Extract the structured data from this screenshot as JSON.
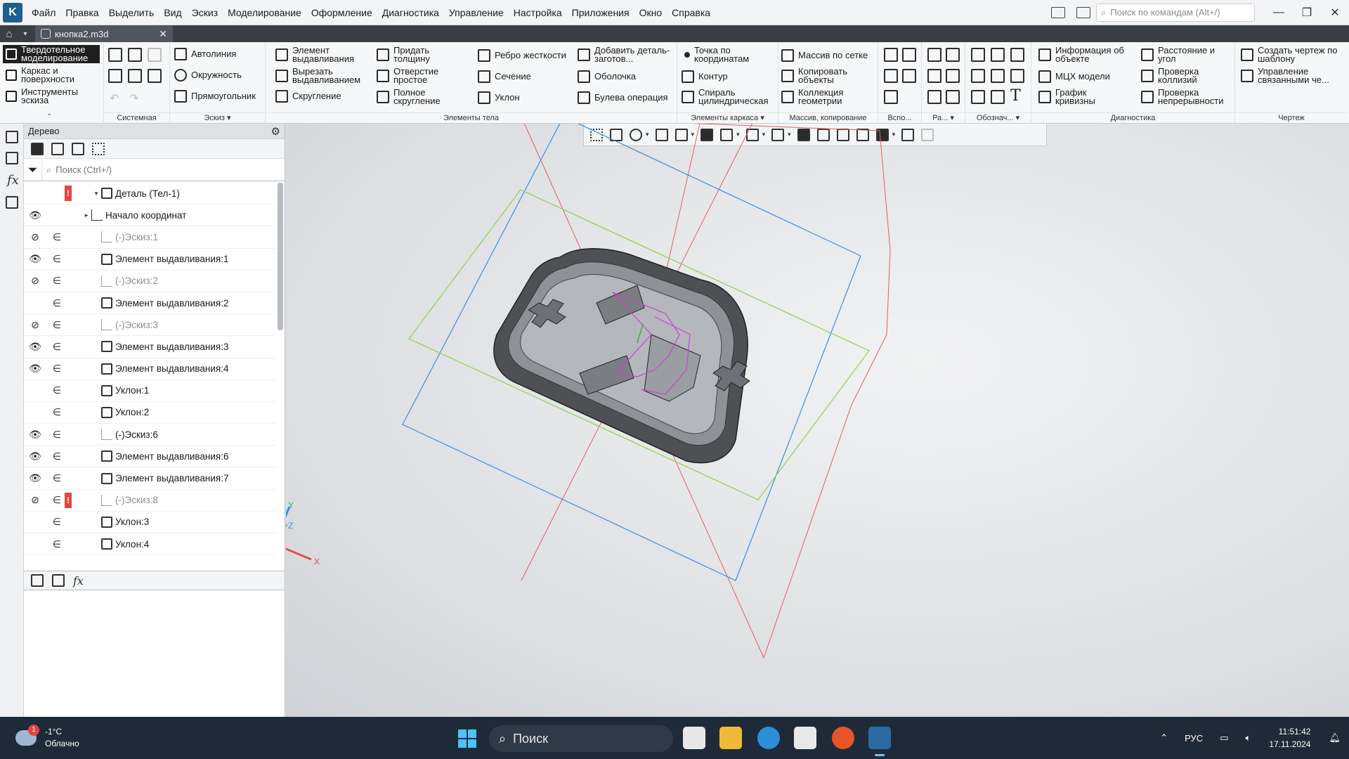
{
  "menubar": {
    "items": [
      "Файл",
      "Правка",
      "Выделить",
      "Вид",
      "Эскиз",
      "Моделирование",
      "Оформление",
      "Диагностика",
      "Управление",
      "Настройка",
      "Приложения",
      "Окно",
      "Справка"
    ],
    "search_placeholder": "Поиск по командам (Alt+/)"
  },
  "tabs": {
    "document": "кнопка2.m3d"
  },
  "ribbon": {
    "modes": [
      "Твердотельное моделирование",
      "Каркас и поверхности",
      "Инструменты эскиза"
    ],
    "groups": {
      "system": "Системная",
      "sketch": "Эскиз",
      "body_elements": "Элементы тела",
      "frame_elements": "Элементы каркаса",
      "array_copy": "Массив, копирование",
      "aux": "Вспо...",
      "ra": "Ра...",
      "designations": "Обознач...",
      "diagnostics": "Диагностика",
      "drawing": "Чертеж"
    },
    "sketch_cmds": [
      "Автолиния",
      "Окружность",
      "Прямоугольник"
    ],
    "body_cmds": [
      "Элемент выдавливания",
      "Вырезать выдавливанием",
      "Скругление",
      "Придать толщину",
      "Отверстие простое",
      "Полное скругление",
      "Ребро жесткости",
      "Сечение",
      "Уклон",
      "Добавить деталь-заготов...",
      "Оболочка",
      "Булева операция"
    ],
    "frame_cmds": [
      "Точка по координатам",
      "Контур",
      "Спираль цилиндрическая"
    ],
    "array_cmds": [
      "Массив по сетке",
      "Копировать объекты",
      "Коллекция геометрии"
    ],
    "diag_cmds": [
      "Информация об объекте",
      "МЦХ модели",
      "График кривизны",
      "Расстояние и угол",
      "Проверка коллизий",
      "Проверка непрерывности"
    ],
    "drawing_cmds": [
      "Создать чертеж по шаблону",
      "Управление связанными че..."
    ]
  },
  "tree": {
    "title": "Дерево",
    "search_placeholder": "Поиск (Ctrl+/)",
    "items": [
      {
        "name": "Деталь (Тел-1)",
        "eye": "",
        "state": "",
        "error": true,
        "dim": false,
        "type": "part",
        "expander": "▾"
      },
      {
        "name": "Начало координат",
        "eye": "👁",
        "state": "",
        "error": false,
        "dim": false,
        "type": "origin",
        "expander": "▸"
      },
      {
        "name": "(-)Эскиз:1",
        "eye": "⊘",
        "state": "∈",
        "error": false,
        "dim": true,
        "type": "sketch",
        "expander": ""
      },
      {
        "name": "Элемент выдавливания:1",
        "eye": "👁",
        "state": "∈",
        "error": false,
        "dim": false,
        "type": "extrude",
        "expander": ""
      },
      {
        "name": "(-)Эскиз:2",
        "eye": "⊘",
        "state": "∈",
        "error": false,
        "dim": true,
        "type": "sketch",
        "expander": ""
      },
      {
        "name": "Элемент выдавливания:2",
        "eye": "",
        "state": "∈",
        "error": false,
        "dim": false,
        "type": "extrude",
        "expander": ""
      },
      {
        "name": "(-)Эскиз:3",
        "eye": "⊘",
        "state": "∈",
        "error": false,
        "dim": true,
        "type": "sketch",
        "expander": ""
      },
      {
        "name": "Элемент выдавливания:3",
        "eye": "👁",
        "state": "∈",
        "error": false,
        "dim": false,
        "type": "extrude",
        "expander": ""
      },
      {
        "name": "Элемент выдавливания:4",
        "eye": "👁",
        "state": "∈",
        "error": false,
        "dim": false,
        "type": "extrude",
        "expander": ""
      },
      {
        "name": "Уклон:1",
        "eye": "",
        "state": "∈",
        "error": false,
        "dim": false,
        "type": "draft",
        "expander": ""
      },
      {
        "name": "Уклон:2",
        "eye": "",
        "state": "∈",
        "error": false,
        "dim": false,
        "type": "draft",
        "expander": ""
      },
      {
        "name": "(-)Эскиз:6",
        "eye": "👁",
        "state": "∈",
        "error": false,
        "dim": false,
        "type": "sketch",
        "expander": ""
      },
      {
        "name": "Элемент выдавливания:6",
        "eye": "👁",
        "state": "∈",
        "error": false,
        "dim": false,
        "type": "extrude",
        "expander": ""
      },
      {
        "name": "Элемент выдавливания:7",
        "eye": "👁",
        "state": "∈",
        "error": false,
        "dim": false,
        "type": "extrude",
        "expander": ""
      },
      {
        "name": "(-)Эскиз:8",
        "eye": "⊘",
        "state": "∈",
        "error": true,
        "dim": true,
        "type": "sketch",
        "expander": ""
      },
      {
        "name": "Уклон:3",
        "eye": "",
        "state": "∈",
        "error": false,
        "dim": false,
        "type": "draft",
        "expander": ""
      },
      {
        "name": "Уклон:4",
        "eye": "",
        "state": "∈",
        "error": false,
        "dim": false,
        "type": "draft",
        "expander": ""
      }
    ]
  },
  "viewport": {
    "axes": {
      "x": "X",
      "y": "Y",
      "z": "Z"
    },
    "colors": {
      "plane_blue": "#3a8fe0",
      "plane_green": "#8fd14f",
      "plane_red": "#e06060",
      "sketch": "#d040d0",
      "body": "#5a5c60"
    }
  },
  "taskbar": {
    "weather_temp": "-1°C",
    "weather_desc": "Облачно",
    "weather_badge": "1",
    "search_label": "Поиск",
    "lang": "РУС",
    "time": "11:51:42",
    "date": "17.11.2024"
  }
}
